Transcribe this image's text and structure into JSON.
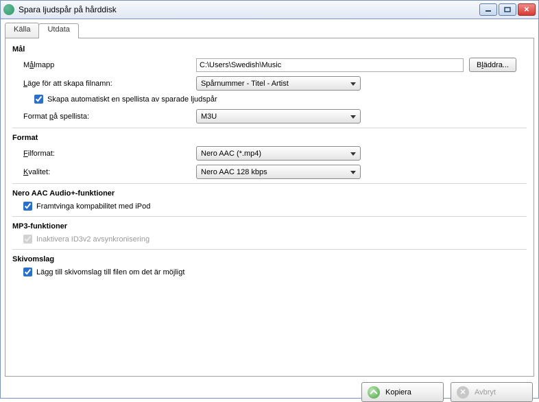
{
  "titlebar": {
    "title": "Spara ljudspår på hårddisk"
  },
  "tabs": {
    "kalla": "Källa",
    "utdata": "Utdata"
  },
  "mal": {
    "heading": "Mål",
    "targetDirLabelPre": "M",
    "targetDirLabelU": "å",
    "targetDirLabelPost": "lmapp",
    "targetDirValue": "C:\\Users\\Swedish\\Music",
    "browsePre": "B",
    "browseU": "l",
    "browsePost": "äddra...",
    "filenameModePre": "",
    "filenameModeU": "L",
    "filenameModePost": "äge för att skapa filnamn:",
    "filenameModeSelected": "Spårnummer - Titel - Artist",
    "createPlaylistPre": "",
    "createPlaylistU": "S",
    "createPlaylistPost": "kapa automatiskt en spellista av sparade ljudspår",
    "createPlaylistChecked": true,
    "playlistFormatPre": "Format ",
    "playlistFormatU": "p",
    "playlistFormatPost": "å spellista:",
    "playlistFormatSelected": "M3U"
  },
  "format": {
    "heading": "Format",
    "fileFormatPre": "",
    "fileFormatU": "F",
    "fileFormatPost": "ilformat:",
    "fileFormatSelected": "Nero AAC (*.mp4)",
    "qualityPre": "",
    "qualityU": "K",
    "qualityPost": "valitet:",
    "qualitySelected": "Nero AAC 128 kbps"
  },
  "aac": {
    "heading": "Nero AAC Audio+-funktioner",
    "ipodPre": "",
    "ipodU": "F",
    "ipodPost": "ramtvinga kompabilitet med iPod",
    "ipodChecked": true
  },
  "mp3": {
    "heading": "MP3-funktioner",
    "id3Pre": "Inaktivera ",
    "id3U": "I",
    "id3Post": "D3v2 avsynkronisering",
    "id3Checked": true,
    "id3Disabled": true
  },
  "albumart": {
    "heading": "Skivomslag",
    "addPre": "",
    "addU": "L",
    "addPost": "ägg till skivomslag till filen om det är möjligt",
    "addChecked": true
  },
  "footer": {
    "kopieraPre": "",
    "kopieraU": "K",
    "kopieraPost": "opiera",
    "avbrytPre": "",
    "avbrytU": "A",
    "avbrytPost": "vbryt"
  }
}
